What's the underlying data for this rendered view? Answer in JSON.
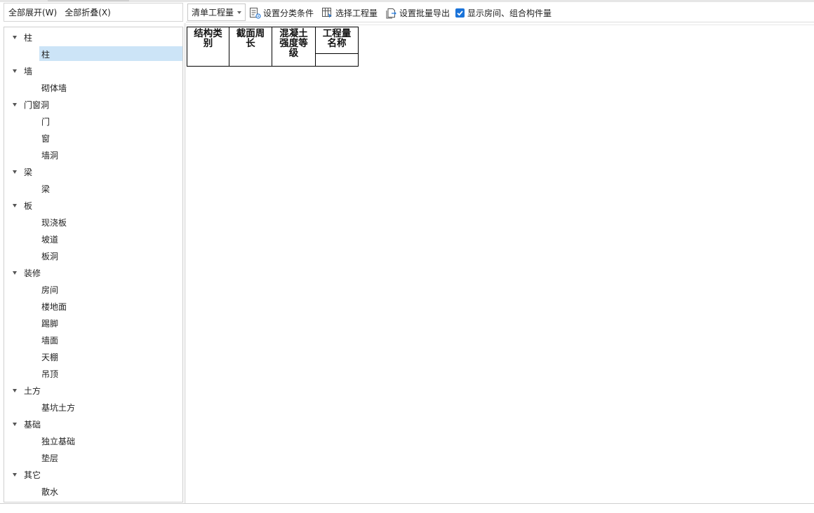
{
  "left_panel": {
    "expand_all_label": "全部展开(W)",
    "collapse_all_label": "全部折叠(X)",
    "tree": [
      {
        "label": "柱",
        "children": [
          "柱"
        ]
      },
      {
        "label": "墙",
        "children": [
          "砌体墙"
        ]
      },
      {
        "label": "门窗洞",
        "children": [
          "门",
          "窗",
          "墙洞"
        ]
      },
      {
        "label": "梁",
        "children": [
          "梁"
        ]
      },
      {
        "label": "板",
        "children": [
          "现浇板",
          "坡道",
          "板洞"
        ]
      },
      {
        "label": "装修",
        "children": [
          "房间",
          "楼地面",
          "踢脚",
          "墙面",
          "天棚",
          "吊顶"
        ]
      },
      {
        "label": "土方",
        "children": [
          "基坑土方"
        ]
      },
      {
        "label": "基础",
        "children": [
          "独立基础",
          "垫层"
        ]
      },
      {
        "label": "其它",
        "children": [
          "散水"
        ]
      }
    ],
    "selected": {
      "group": 0,
      "child": 0
    }
  },
  "toolbar": {
    "dropdown_value": "清单工程量",
    "set_category_label": "设置分类条件",
    "select_quantity_label": "选择工程量",
    "batch_export_label": "设置批量导出",
    "show_rooms_label": "显示房间、组合构件量",
    "show_rooms_checked": true
  },
  "table": {
    "col1": [
      "结构类",
      "别"
    ],
    "col2": [
      "截面周",
      "长"
    ],
    "col3": [
      "混凝土",
      "强度等",
      "级"
    ],
    "col4": [
      "工程量",
      "名称"
    ]
  },
  "colors": {
    "selection": "#cce4f7",
    "checkbox": "#1a73d9"
  }
}
